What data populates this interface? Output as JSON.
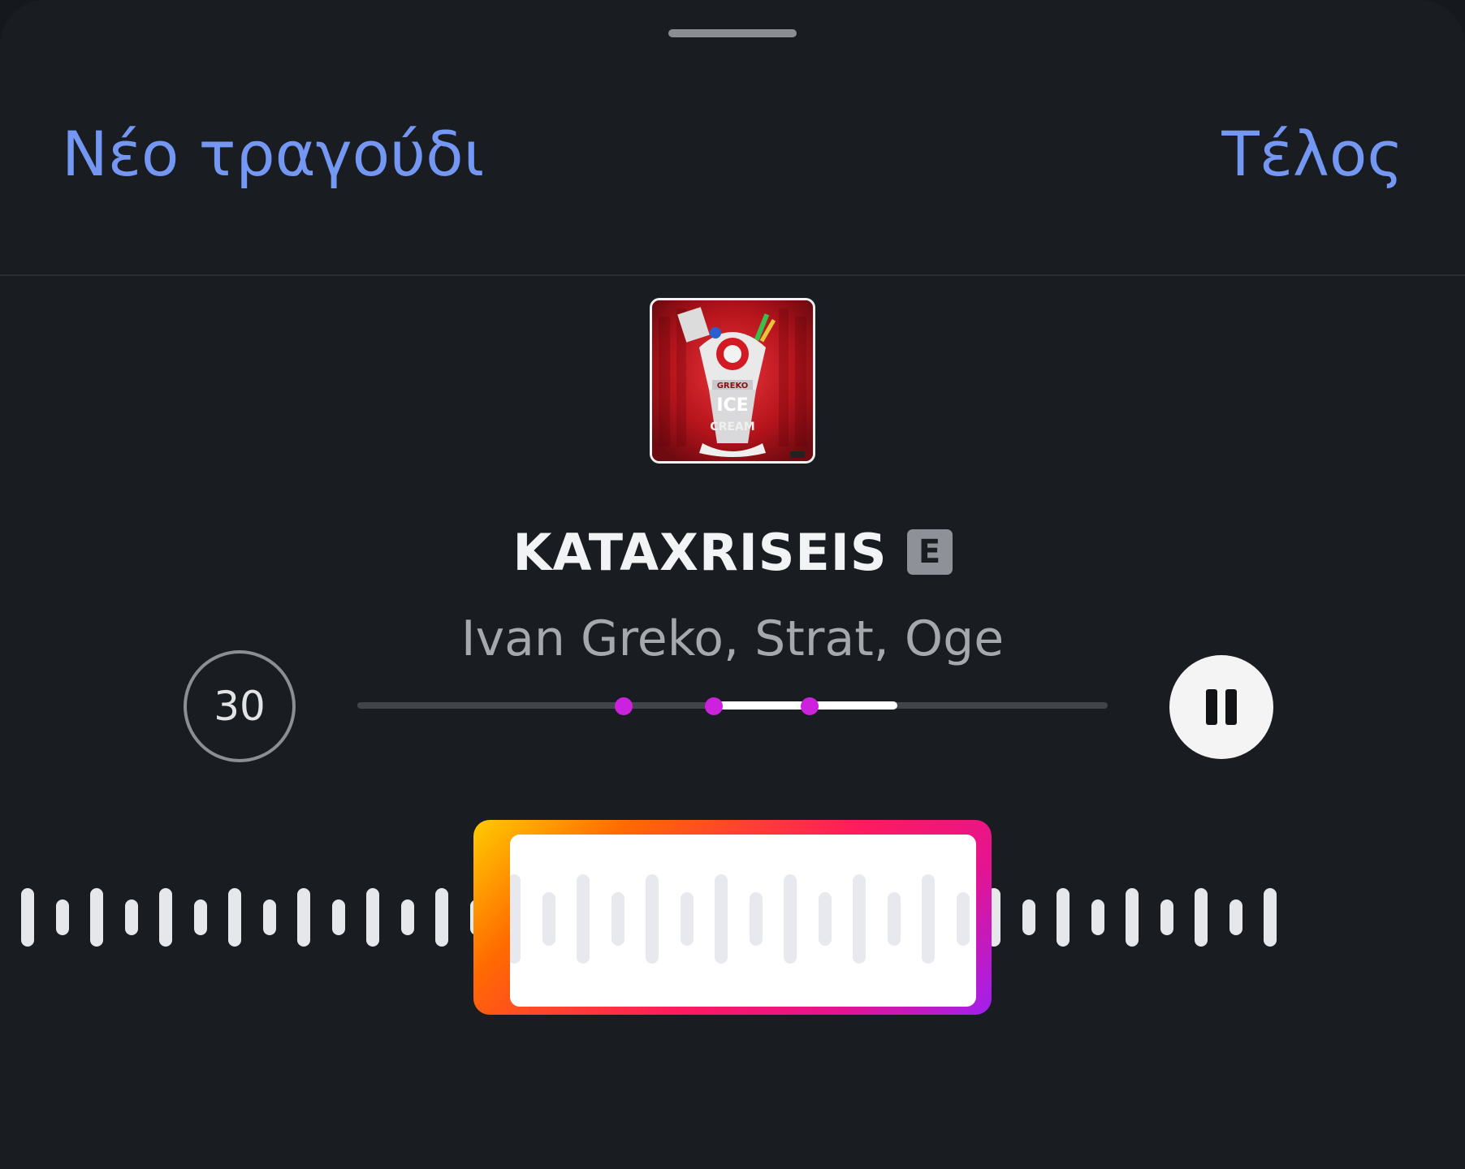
{
  "header": {
    "left_action": "Νέο τραγούδι",
    "right_action": "Τέλος"
  },
  "track": {
    "title": "KATAXRISEIS",
    "explicit_badge": "E",
    "artists": "Ivan Greko, Strat, Oge",
    "album_art_icon": "album-cover-image"
  },
  "controls": {
    "duration_label": "30",
    "play_state": "playing",
    "pause_icon": "pause-icon",
    "scrubber": {
      "selected_start": 0.475,
      "selected_end": 0.72,
      "markers": [
        0.355,
        0.475,
        0.603
      ]
    }
  },
  "colors": {
    "accent": "#7497f4",
    "marker": "#cc22dd",
    "selection_gradient": [
      "#ffcc00",
      "#ff6a00",
      "#ff1a5e",
      "#e5148f",
      "#a020f0"
    ]
  }
}
